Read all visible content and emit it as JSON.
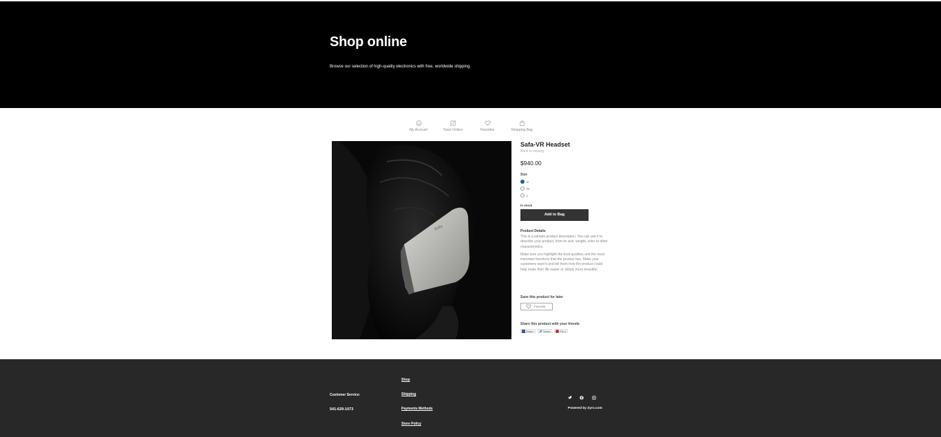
{
  "hero": {
    "title": "Shop online",
    "subtitle": "Browse our selection of high-quality electronics with free, worldwide shipping."
  },
  "nav": {
    "items": [
      {
        "label": "My Account",
        "icon": "smiley-icon"
      },
      {
        "label": "Track Orders",
        "icon": "edit-icon"
      },
      {
        "label": "Favorites",
        "icon": "heart-icon"
      },
      {
        "label": "Shopping Bag",
        "icon": "bag-icon"
      }
    ]
  },
  "product": {
    "name": "Safa-VR Headset",
    "back_link": "Back to catalog",
    "price": "$940.00",
    "size_label": "Size",
    "sizes": [
      {
        "label": "S",
        "selected": true
      },
      {
        "label": "M",
        "selected": false
      },
      {
        "label": "L",
        "selected": false
      }
    ],
    "stock": "In stock",
    "add_button": "Add to Bag",
    "details_title": "Product Details",
    "details_p1": "This is a sample product description. You can use it to describe your product, from its size, weight, color to other characteristics.",
    "details_p2": "Make sure you highlight the best qualities and the most important functions that the product has. Make your customers want it and tell them how the product could help make their life easier or simply more beautiful.",
    "save_title": "Save this product for later",
    "favorite_button": "Favorite",
    "share_title": "Share this product with your friends",
    "share": {
      "facebook": "Share",
      "twitter": "Tweet",
      "pinterest": "Pin it"
    },
    "image_brand": "Safa"
  },
  "footer": {
    "customer_service": "Customer Service:",
    "phone": "541-629-1073",
    "links": [
      "Shop",
      "Shipping",
      "Payments Methods",
      "Store Policy"
    ],
    "powered_by": "Powered by Zyro.com"
  },
  "colors": {
    "hero_bg": "#000000",
    "footer_bg": "#272827",
    "button_bg": "#333333",
    "radio_selected": "#2a5ba8"
  }
}
